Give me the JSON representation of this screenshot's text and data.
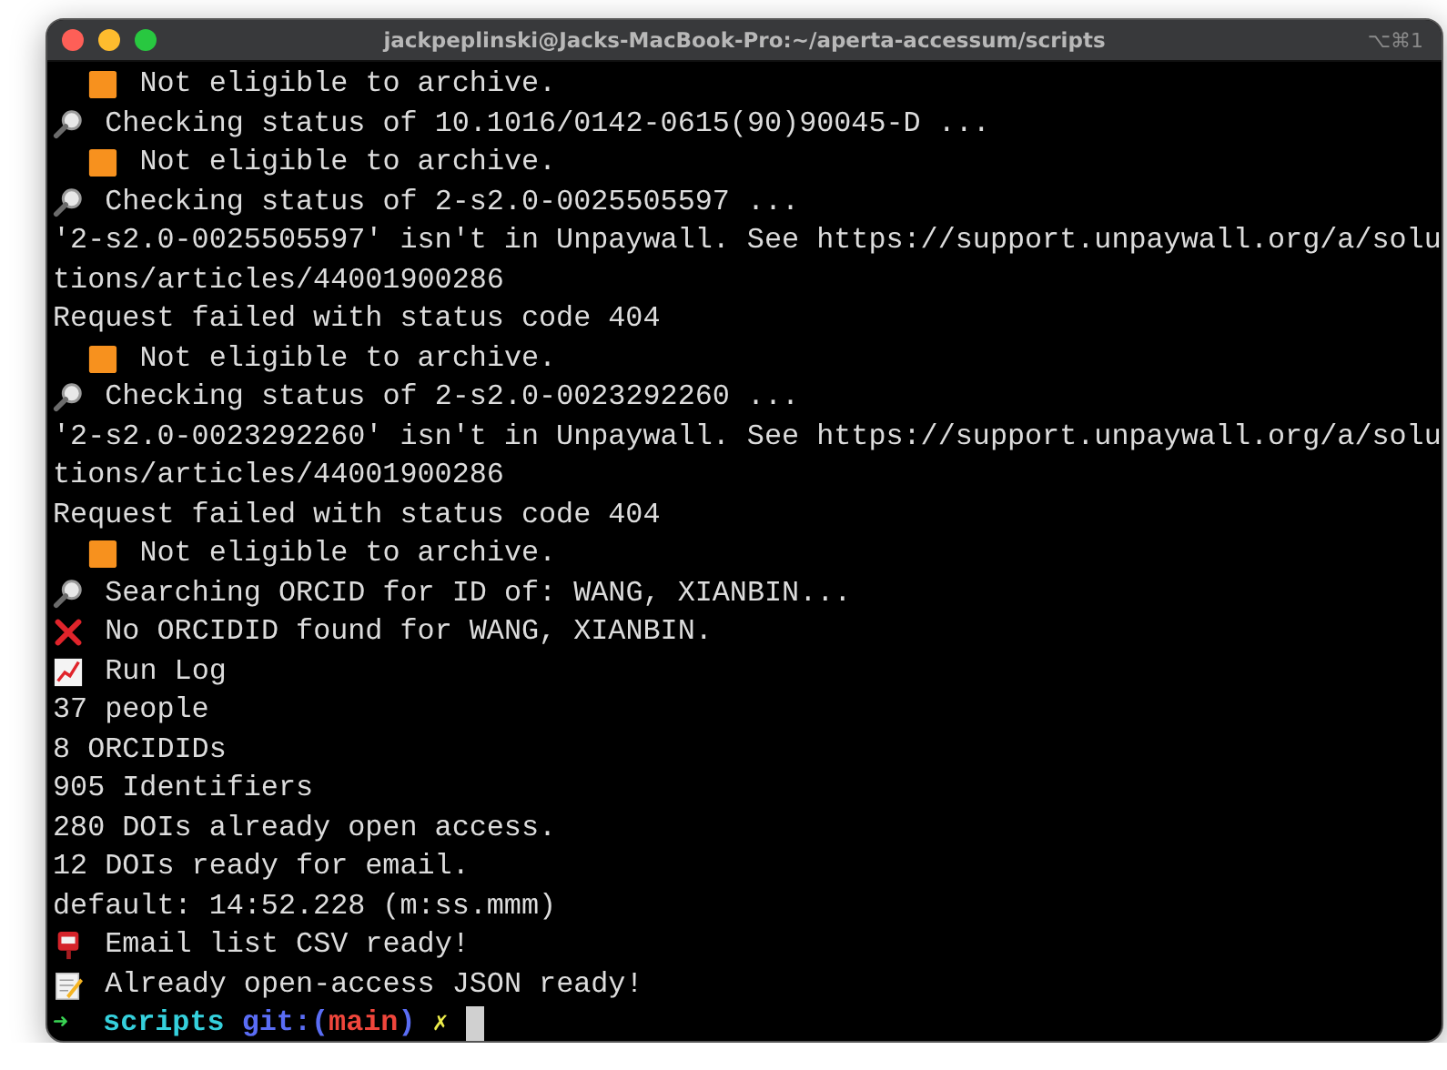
{
  "window": {
    "title": "jackpeplinski@Jacks-MacBook-Pro:~/aperta-accessum/scripts",
    "shortcut": "⌥⌘1"
  },
  "lines": [
    {
      "kind": "ineligible",
      "text": "Not eligible to archive."
    },
    {
      "kind": "search",
      "text": "Checking status of 10.1016/0142-0615(90)90045-D ..."
    },
    {
      "kind": "ineligible",
      "text": "Not eligible to archive."
    },
    {
      "kind": "search",
      "text": "Checking status of 2-s2.0-0025505597 ..."
    },
    {
      "kind": "plain",
      "text": "'2-s2.0-0025505597' isn't in Unpaywall. See https://support.unpaywall.org/a/solu"
    },
    {
      "kind": "plain",
      "text": "tions/articles/44001900286"
    },
    {
      "kind": "plain",
      "text": "Request failed with status code 404"
    },
    {
      "kind": "ineligible",
      "text": "Not eligible to archive."
    },
    {
      "kind": "search",
      "text": "Checking status of 2-s2.0-0023292260 ..."
    },
    {
      "kind": "plain",
      "text": "'2-s2.0-0023292260' isn't in Unpaywall. See https://support.unpaywall.org/a/solu"
    },
    {
      "kind": "plain",
      "text": "tions/articles/44001900286"
    },
    {
      "kind": "plain",
      "text": "Request failed with status code 404"
    },
    {
      "kind": "ineligible",
      "text": "Not eligible to archive."
    },
    {
      "kind": "search",
      "text": "Searching ORCID for ID of: WANG, XIANBIN..."
    },
    {
      "kind": "error",
      "text": "No ORCIDID found for WANG, XIANBIN."
    },
    {
      "kind": "log",
      "text": "Run Log"
    },
    {
      "kind": "plain",
      "text": "37 people"
    },
    {
      "kind": "plain",
      "text": "8 ORCIDIDs"
    },
    {
      "kind": "plain",
      "text": "905 Identifiers"
    },
    {
      "kind": "plain",
      "text": "280 DOIs already open access."
    },
    {
      "kind": "plain",
      "text": "12 DOIs ready for email."
    },
    {
      "kind": "plain",
      "text": "default: 14:52.228 (m:ss.mmm)"
    },
    {
      "kind": "mail",
      "text": "Email list CSV ready!"
    },
    {
      "kind": "note",
      "text": "Already open-access JSON ready!"
    }
  ],
  "prompt": {
    "arrow": "➜",
    "directory": "scripts",
    "git_prefix": "git:(",
    "branch": "main",
    "git_suffix": ")",
    "dirty_mark": "✗"
  }
}
